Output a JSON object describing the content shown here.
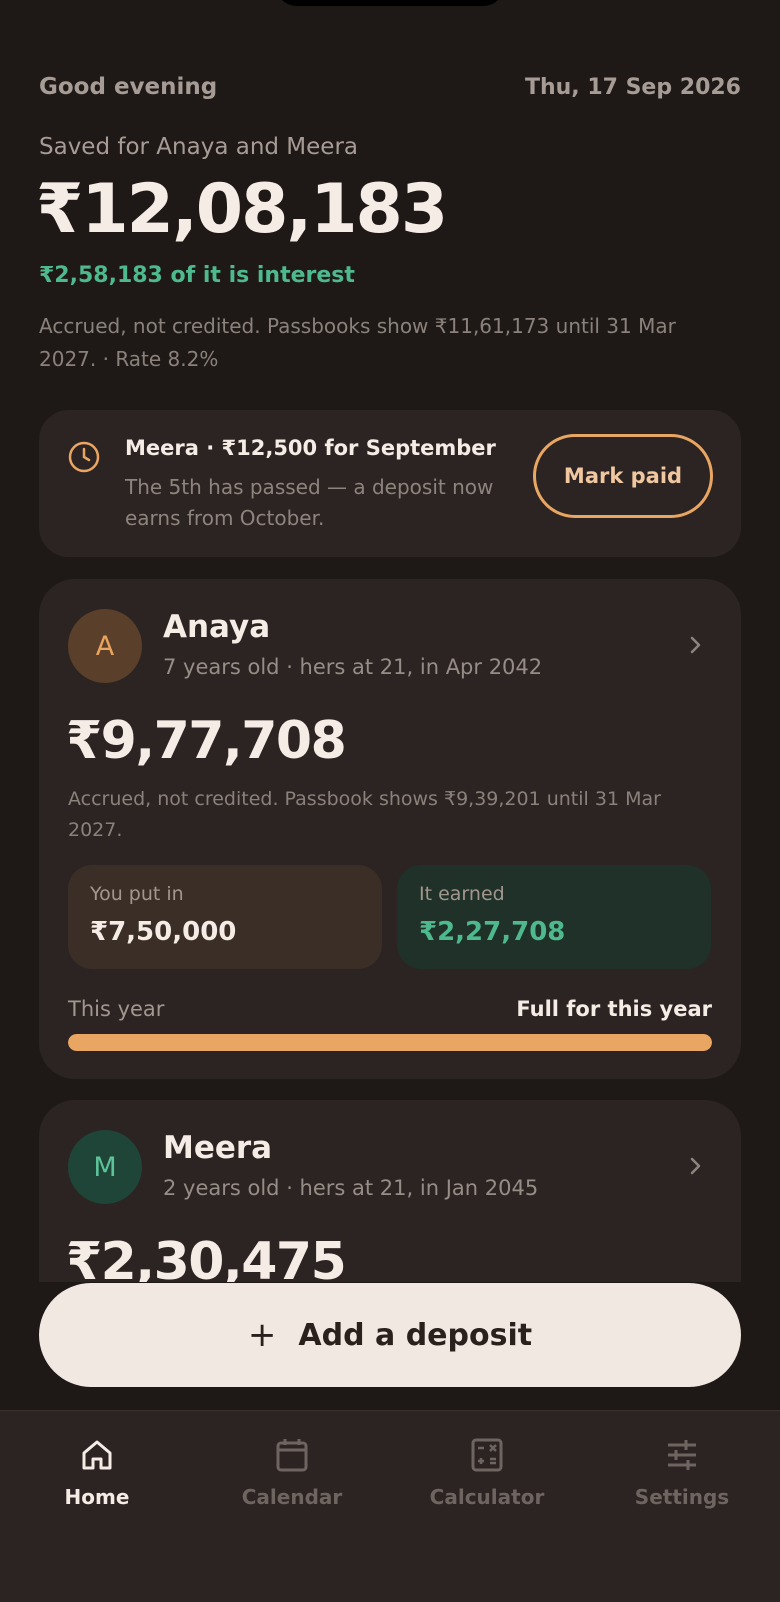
{
  "header": {
    "greeting": "Good evening",
    "date": "Thu, 17 Sep 2026"
  },
  "summary": {
    "saved_label": "Saved for Anaya and Meera",
    "total": "₹12,08,183",
    "interest_line": "₹2,58,183 of it is interest",
    "note": "Accrued, not credited. Passbooks show ₹11,61,173 until 31 Mar 2027. · Rate 8.2%"
  },
  "reminder": {
    "title": "Meera · ₹12,500 for September",
    "text": "The 5th has passed — a deposit now earns from October.",
    "button_label": "Mark paid",
    "icon": "clock-icon"
  },
  "children": [
    {
      "initial": "A",
      "name": "Anaya",
      "subtitle": "7 years old · hers at 21, in Apr 2042",
      "amount": "₹9,77,708",
      "note": "Accrued, not credited. Passbook shows ₹9,39,201 until 31 Mar 2027.",
      "put_in_label": "You put in",
      "put_in_value": "₹7,50,000",
      "earned_label": "It earned",
      "earned_value": "₹2,27,708",
      "year_label": "This year",
      "year_status": "Full for this year",
      "year_progress": 1.0
    },
    {
      "initial": "M",
      "name": "Meera",
      "subtitle": "2 years old · hers at 21, in Jan 2045",
      "amount": "₹2,30,475"
    }
  ],
  "add_button": {
    "label": "Add a deposit",
    "icon": "plus-icon"
  },
  "tabs": [
    {
      "label": "Home",
      "icon": "home-icon",
      "active": true
    },
    {
      "label": "Calendar",
      "icon": "calendar-icon",
      "active": false
    },
    {
      "label": "Calculator",
      "icon": "calculator-icon",
      "active": false
    },
    {
      "label": "Settings",
      "icon": "sliders-icon",
      "active": false
    }
  ],
  "colors": {
    "background": "#1e1917",
    "card": "#2c2422",
    "accent": "#e9a663",
    "positive": "#4fb98e"
  }
}
